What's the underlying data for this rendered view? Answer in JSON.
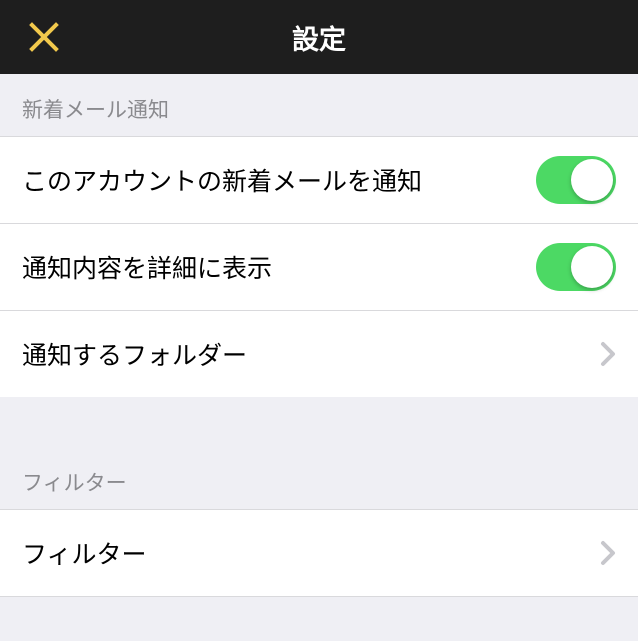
{
  "header": {
    "title": "設定"
  },
  "sections": {
    "notifications": {
      "header": "新着メール通知",
      "notify_account_label": "このアカウントの新着メールを通知",
      "notify_account_on": true,
      "show_detail_label": "通知内容を詳細に表示",
      "show_detail_on": true,
      "notify_folder_label": "通知するフォルダー"
    },
    "filter": {
      "header": "フィルター",
      "filter_label": "フィルター"
    }
  },
  "colors": {
    "accent_close": "#f2c94c",
    "toggle_on": "#4cd964"
  }
}
